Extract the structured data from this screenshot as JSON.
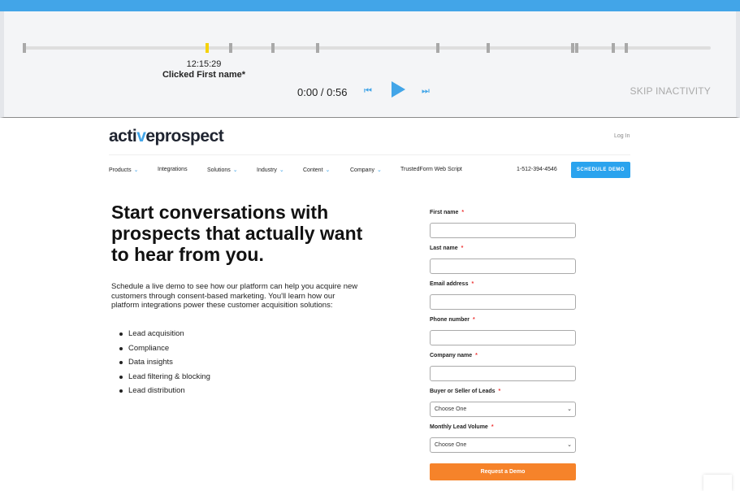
{
  "player": {
    "tooltip_time": "12:15:29",
    "tooltip_event": "Clicked First name*",
    "time": "0:00 / 0:56",
    "skip_label": "SKIP INACTIVITY",
    "accent": "#42a5e8",
    "active_marker": "#f5d20a"
  },
  "site": {
    "logo_prefix": "acti",
    "logo_v": "v",
    "logo_suffix": "eprospect",
    "login": "Log In",
    "nav": [
      {
        "label": "Products",
        "dropdown": true
      },
      {
        "label": "Integrations",
        "dropdown": false
      },
      {
        "label": "Solutions",
        "dropdown": true
      },
      {
        "label": "Industry",
        "dropdown": true
      },
      {
        "label": "Content",
        "dropdown": true
      },
      {
        "label": "Company",
        "dropdown": true
      },
      {
        "label": "TrustedForm Web Script",
        "dropdown": false
      }
    ],
    "phone": "1-512-394-4546",
    "cta": "SCHEDULE DEMO",
    "headline": "Start conversations with prospects that actually want to hear from you.",
    "intro": "Schedule a live demo to see how our platform can help you acquire new customers through consent-based marketing. You'll learn how our platform integrations power these customer acquisition solutions:",
    "bullets": [
      "Lead acquisition",
      "Compliance",
      "Data insights",
      "Lead filtering & blocking",
      "Lead distribution"
    ],
    "form": {
      "fields": [
        {
          "label": "First name"
        },
        {
          "label": "Last name"
        },
        {
          "label": "Email address"
        },
        {
          "label": "Phone number"
        },
        {
          "label": "Company name"
        },
        {
          "label": "Buyer or Seller of Leads",
          "value": "Choose One"
        },
        {
          "label": "Monthly Lead Volume",
          "value": "Choose One"
        }
      ],
      "required_mark": "*",
      "submit": "Request a Demo"
    }
  }
}
